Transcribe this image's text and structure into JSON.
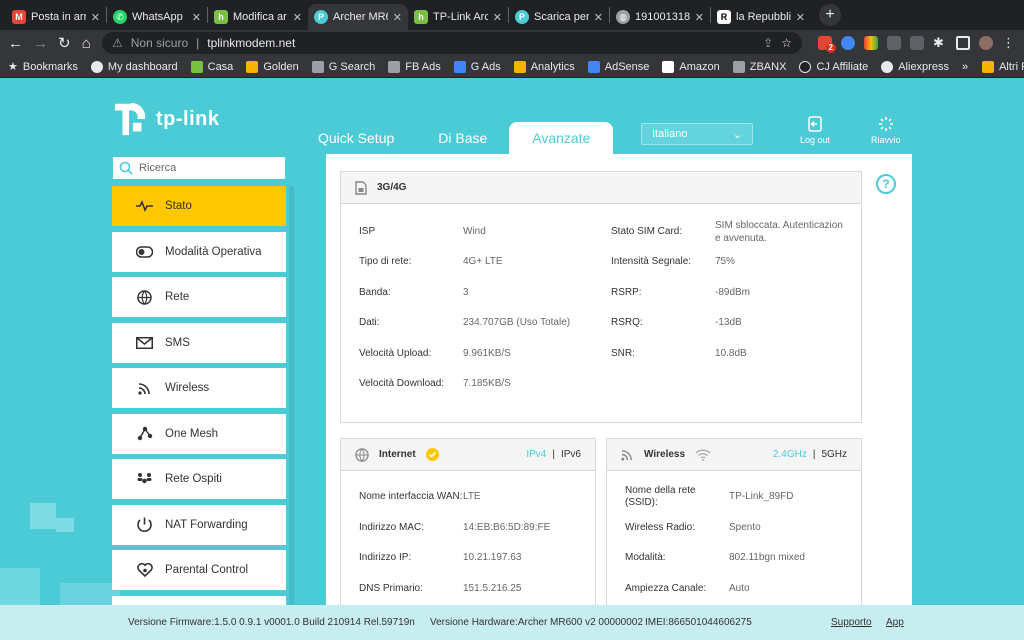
{
  "browser": {
    "tabs": [
      {
        "title": "Posta in arr",
        "icon": "gmail-icon",
        "color": "#ea4335"
      },
      {
        "title": "WhatsApp",
        "icon": "whatsapp-icon",
        "color": "#25d366"
      },
      {
        "title": "Modifica ar",
        "icon": "houzz-icon",
        "color": "#7ac142"
      },
      {
        "title": "Archer MR6",
        "icon": "tplink-icon",
        "color": "#4acbd6"
      },
      {
        "title": "TP-Link Arc",
        "icon": "houzz-icon",
        "color": "#7ac142"
      },
      {
        "title": "Scarica per",
        "icon": "tplink-icon",
        "color": "#4acbd6"
      },
      {
        "title": "1910013181",
        "icon": "globe-icon",
        "color": "#9aa0a6"
      },
      {
        "title": "la Repubblic",
        "icon": "repubblica-icon",
        "color": "#ffffff"
      }
    ],
    "not_secure": "Non sicuro",
    "url": "tplinkmodem.net",
    "bookmarks": [
      {
        "label": "Bookmarks",
        "color": "#4285f4"
      },
      {
        "label": "My dashboard",
        "color": "#e8eaed"
      },
      {
        "label": "Casa",
        "color": "#7ac142"
      },
      {
        "label": "Golden",
        "color": "#f4b400"
      },
      {
        "label": "G Search",
        "color": "#9aa0a6"
      },
      {
        "label": "FB Ads",
        "color": "#9aa0a6"
      },
      {
        "label": "G Ads",
        "color": "#4285f4"
      },
      {
        "label": "Analytics",
        "color": "#f4b400"
      },
      {
        "label": "AdSense",
        "color": "#4285f4"
      },
      {
        "label": "Amazon",
        "color": "#ffffff"
      },
      {
        "label": "ZBANX",
        "color": "#9aa0a6"
      },
      {
        "label": "CJ Affiliate",
        "color": "#202124"
      },
      {
        "label": "Aliexpress",
        "color": "#e8eaed"
      }
    ],
    "bookmarks_more": "»",
    "other_bookmarks": "Altri Preferiti",
    "ext_badge": "2"
  },
  "router": {
    "brand": "tp-link",
    "nav": {
      "quick_setup": "Quick Setup",
      "basic": "Di Base",
      "advanced": "Avanzate"
    },
    "language": "Italiano",
    "logout": "Log out",
    "reboot": "Riavvio",
    "search_placeholder": "Ricerca",
    "menu": [
      {
        "label": "Stato",
        "icon": "pulse-icon"
      },
      {
        "label": "Modalità Operativa",
        "icon": "toggle-icon"
      },
      {
        "label": "Rete",
        "icon": "globe-icon"
      },
      {
        "label": "SMS",
        "icon": "envelope-icon"
      },
      {
        "label": "Wireless",
        "icon": "wifi-icon"
      },
      {
        "label": "One Mesh",
        "icon": "mesh-icon"
      },
      {
        "label": "Rete Ospiti",
        "icon": "guests-icon"
      },
      {
        "label": "NAT Forwarding",
        "icon": "nat-icon"
      },
      {
        "label": "Parental Control",
        "icon": "heart-icon"
      }
    ],
    "lte": {
      "title": "3G/4G",
      "isp_l": "ISP",
      "isp_v": "Wind",
      "type_l": "Tipo di rete:",
      "type_v": "4G+ LTE",
      "band_l": "Banda:",
      "band_v": "3",
      "data_l": "Dati:",
      "data_v": "234.707GB (Uso Totale)",
      "up_l": "Velocità Upload:",
      "up_v": "9.961KB/S",
      "down_l": "Velocità Download:",
      "down_v": "7.185KB/S",
      "sim_l": "Stato SIM Card:",
      "sim_v1": "SIM sbloccata. Autenticazion",
      "sim_v2": "e avvenuta.",
      "sig_l": "Intensità Segnale:",
      "sig_v": "75%",
      "rsrp_l": "RSRP:",
      "rsrp_v": "-89dBm",
      "rsrq_l": "RSRQ:",
      "rsrq_v": "-13dB",
      "snr_l": "SNR:",
      "snr_v": "10.8dB"
    },
    "internet": {
      "title": "Internet",
      "ipv4": "IPv4",
      "sep": "|",
      "ipv6": "IPv6",
      "wan_l": "Nome interfaccia WAN:",
      "wan_v": "LTE",
      "mac_l": "Indirizzo MAC:",
      "mac_v": "14:EB:B6:5D:89:FE",
      "ip_l": "Indirizzo IP:",
      "ip_v": "10.21.197.63",
      "dns_l": "DNS Primario:",
      "dns_v": "151.5.216.25"
    },
    "wireless": {
      "title": "Wireless",
      "b24": "2.4GHz",
      "sep": "|",
      "b5": "5GHz",
      "ssid_l1": "Nome della rete",
      "ssid_l2": "(SSID):",
      "ssid_v": "TP-Link_89FD",
      "radio_l": "Wireless Radio:",
      "radio_v": "Spento",
      "mode_l": "Modalità:",
      "mode_v": "802.11bgn mixed",
      "width_l": "Ampiezza Canale:",
      "width_v": "Auto"
    },
    "footer": {
      "firmware": "Versione Firmware:1.5.0 0.9.1 v0001.0 Build 210914 Rel.59719n",
      "hardware": "Versione Hardware:Archer MR600 v2 00000002",
      "imei": "IMEI:866501044606275",
      "support": "Supporto",
      "app": "App"
    },
    "colors": {
      "accent": "#4acbd6",
      "active": "#ffc700"
    }
  }
}
